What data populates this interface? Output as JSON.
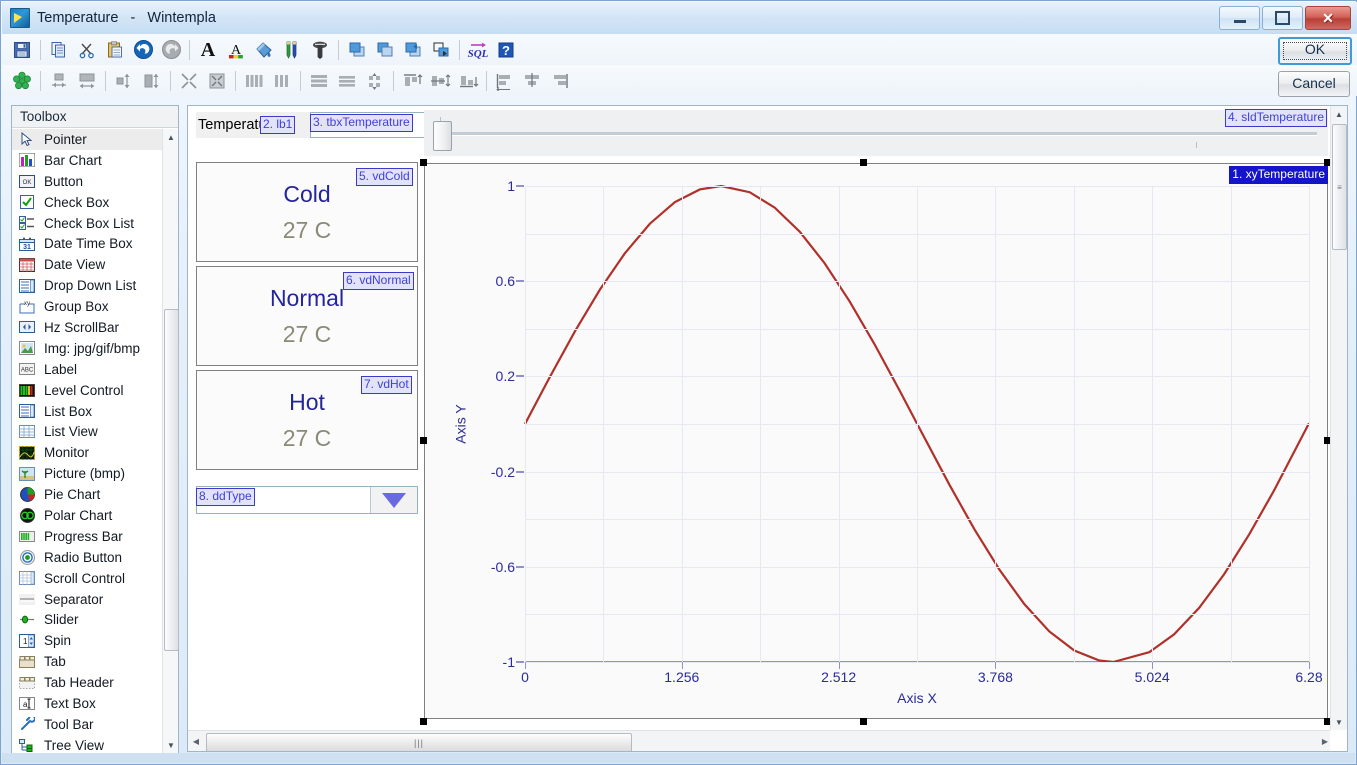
{
  "window": {
    "title": "Temperature   -   Wintempla",
    "app_icon": "wintempla-icon",
    "buttons": {
      "minimize": "minimize-icon",
      "maximize": "maximize-icon",
      "close": "close-icon"
    }
  },
  "dialog_buttons": {
    "ok": "OK",
    "cancel": "Cancel"
  },
  "toolbar_row1": [
    {
      "name": "save-icon",
      "label": "Save"
    },
    {
      "name": "copy-icon",
      "label": "Copy"
    },
    {
      "name": "cut-icon",
      "label": "Cut"
    },
    {
      "name": "paste-icon",
      "label": "Paste"
    },
    {
      "name": "undo-icon",
      "label": "Undo"
    },
    {
      "name": "redo-icon",
      "label": "Redo"
    },
    {
      "name": "bold-font-icon",
      "label": "Font"
    },
    {
      "name": "font-color-icon",
      "label": "Font Color"
    },
    {
      "name": "fill-color-icon",
      "label": "Fill Color"
    },
    {
      "name": "pencils-icon",
      "label": "Pen Color"
    },
    {
      "name": "screw-icon",
      "label": "Properties"
    },
    {
      "name": "bring-to-front-icon",
      "label": "Bring To Front"
    },
    {
      "name": "send-to-back-icon",
      "label": "Send To Back"
    },
    {
      "name": "bring-forward-icon",
      "label": "Bring Forward"
    },
    {
      "name": "send-backward-icon",
      "label": "Send Backward"
    },
    {
      "name": "sql-icon",
      "label": "SQL"
    },
    {
      "name": "help-icon",
      "label": "Help"
    }
  ],
  "toolbar_row2": [
    {
      "name": "snowflake-icon",
      "label": "Snap"
    },
    {
      "name": "make-same-width-icon",
      "label": "Make Same Width"
    },
    {
      "name": "make-same-size-icon",
      "label": "Make Same Size"
    },
    {
      "name": "make-same-height-icon",
      "label": "Make Same Height"
    },
    {
      "name": "size-to-grid-icon",
      "label": "Size To Grid"
    },
    {
      "name": "shrink-icon",
      "label": "Shrink"
    },
    {
      "name": "collapse-icon",
      "label": "Collapse"
    },
    {
      "name": "space-vertically-icon",
      "label": "Space Vertically"
    },
    {
      "name": "increase-vertical-space-icon",
      "label": "Increase Vertical Spacing"
    },
    {
      "name": "space-horizontally-icon",
      "label": "Space Horizontally"
    },
    {
      "name": "remove-horizontal-space-icon",
      "label": "Remove Horizontal Spacing"
    },
    {
      "name": "center-grid-icon",
      "label": "Center In Grid"
    },
    {
      "name": "align-tops-icon",
      "label": "Align Tops"
    },
    {
      "name": "align-middles-icon",
      "label": "Align Middles"
    },
    {
      "name": "align-bottoms-icon",
      "label": "Align Bottoms"
    },
    {
      "name": "align-lefts-icon",
      "label": "Align Lefts"
    },
    {
      "name": "align-centers-icon",
      "label": "Align Centers"
    },
    {
      "name": "align-rights-icon",
      "label": "Align Rights"
    }
  ],
  "toolbox": {
    "header": "Toolbox",
    "selected": "Pointer",
    "items": [
      {
        "label": "Pointer",
        "icon": "pointer-icon"
      },
      {
        "label": "Bar Chart",
        "icon": "bar-chart-icon"
      },
      {
        "label": "Button",
        "icon": "button-icon"
      },
      {
        "label": "Check Box",
        "icon": "check-box-icon"
      },
      {
        "label": "Check Box List",
        "icon": "check-box-list-icon"
      },
      {
        "label": "Date Time Box",
        "icon": "date-time-box-icon"
      },
      {
        "label": "Date View",
        "icon": "date-view-icon"
      },
      {
        "label": "Drop Down List",
        "icon": "drop-down-list-icon"
      },
      {
        "label": "Group Box",
        "icon": "group-box-icon"
      },
      {
        "label": "Hz ScrollBar",
        "icon": "hz-scrollbar-icon"
      },
      {
        "label": "Img: jpg/gif/bmp",
        "icon": "image-icon"
      },
      {
        "label": "Label",
        "icon": "label-icon"
      },
      {
        "label": "Level Control",
        "icon": "level-control-icon"
      },
      {
        "label": "List Box",
        "icon": "list-box-icon"
      },
      {
        "label": "List View",
        "icon": "list-view-icon"
      },
      {
        "label": "Monitor",
        "icon": "monitor-icon"
      },
      {
        "label": "Picture (bmp)",
        "icon": "picture-icon"
      },
      {
        "label": "Pie Chart",
        "icon": "pie-chart-icon"
      },
      {
        "label": "Polar Chart",
        "icon": "polar-chart-icon"
      },
      {
        "label": "Progress Bar",
        "icon": "progress-bar-icon"
      },
      {
        "label": "Radio Button",
        "icon": "radio-button-icon"
      },
      {
        "label": "Scroll Control",
        "icon": "scroll-control-icon"
      },
      {
        "label": "Separator",
        "icon": "separator-icon"
      },
      {
        "label": "Slider",
        "icon": "slider-icon"
      },
      {
        "label": "Spin",
        "icon": "spin-icon"
      },
      {
        "label": "Tab",
        "icon": "tab-icon"
      },
      {
        "label": "Tab Header",
        "icon": "tab-header-icon"
      },
      {
        "label": "Text Box",
        "icon": "text-box-icon"
      },
      {
        "label": "Tool Bar",
        "icon": "tool-bar-icon"
      },
      {
        "label": "Tree View",
        "icon": "tree-view-icon"
      }
    ]
  },
  "designer": {
    "label": {
      "text": "Temperatu",
      "tag": "2. lb1"
    },
    "textbox": {
      "value": "",
      "tag": "3. tbxTemperature"
    },
    "slider": {
      "tag": "4. sldTemperature",
      "value": 0
    },
    "values": [
      {
        "tag": "5. vdCold",
        "name": "Cold",
        "value": "27 C"
      },
      {
        "tag": "6. vdNormal",
        "name": "Normal",
        "value": "27 C"
      },
      {
        "tag": "7. vdHot",
        "name": "Hot",
        "value": "27 C"
      }
    ],
    "dropdown": {
      "tag": "8. ddType",
      "value": "",
      "arrow": "chevron-down-icon"
    },
    "chart_tag": "1. xyTemperature"
  },
  "colors": {
    "curve": "#b0302a",
    "tag_text": "#4040d8",
    "tag_selected_bg": "#1414c8",
    "axis_text": "#2b2b9b",
    "grid": "#e6e9f4"
  },
  "chart_data": {
    "type": "line",
    "title": "",
    "xlabel": "Axis X",
    "ylabel": "Axis Y",
    "xlim": [
      0,
      6.28
    ],
    "ylim": [
      -1,
      1
    ],
    "xticks": [
      0,
      1.256,
      2.512,
      3.768,
      5.024,
      6.28
    ],
    "xtick_labels": [
      "0",
      "1.256",
      "2.512",
      "3.768",
      "5.024",
      "6.28"
    ],
    "yticks": [
      1,
      0.6,
      0.2,
      -0.2,
      -0.6,
      -1
    ],
    "ytick_labels": [
      "1",
      "0.6",
      "0.2",
      "-0.2",
      "-0.6",
      "-1"
    ],
    "grid": true,
    "legend": "none",
    "series": [
      {
        "name": "xyTemperature",
        "color": "#b0302a",
        "x": [
          0,
          0.2,
          0.4,
          0.6,
          0.8,
          1.0,
          1.2,
          1.4,
          1.5708,
          1.8,
          2.0,
          2.2,
          2.4,
          2.6,
          2.8,
          3.0,
          3.1416,
          3.4,
          3.6,
          3.8,
          4.0,
          4.2,
          4.4,
          4.6,
          4.7124,
          5.0,
          5.2,
          5.4,
          5.6,
          5.8,
          6.0,
          6.28
        ],
        "y": [
          0,
          0.1987,
          0.3894,
          0.5646,
          0.7174,
          0.8415,
          0.932,
          0.9854,
          1.0,
          0.9738,
          0.9093,
          0.8085,
          0.6755,
          0.5155,
          0.335,
          0.1411,
          0.0,
          -0.2555,
          -0.4425,
          -0.6119,
          -0.7568,
          -0.8716,
          -0.9516,
          -0.9937,
          -1.0,
          -0.9589,
          -0.8835,
          -0.7728,
          -0.6313,
          -0.4646,
          -0.2794,
          0.0032
        ]
      }
    ]
  }
}
